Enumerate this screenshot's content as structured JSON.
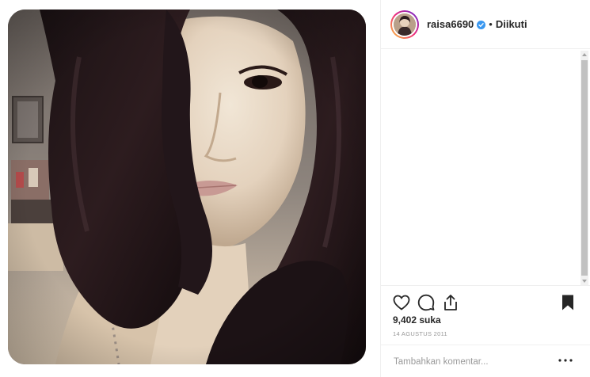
{
  "post": {
    "photo_alt": "",
    "header": {
      "username": "raisa6690",
      "verified_icon": "verified-badge-icon",
      "separator": "•",
      "follow_status": "Diikuti"
    },
    "likes": "9,402 suka",
    "date": "14 AGUSTUS 2011",
    "comment_placeholder": "Tambahkan komentar...",
    "icons": {
      "like": "heart-icon",
      "comment": "comment-icon",
      "share": "share-icon",
      "save": "bookmark-icon",
      "more": "more-options-icon"
    }
  },
  "colors": {
    "accent_blue": "#3897f0",
    "text": "#262626",
    "muted": "#999999",
    "border": "#efefef"
  }
}
